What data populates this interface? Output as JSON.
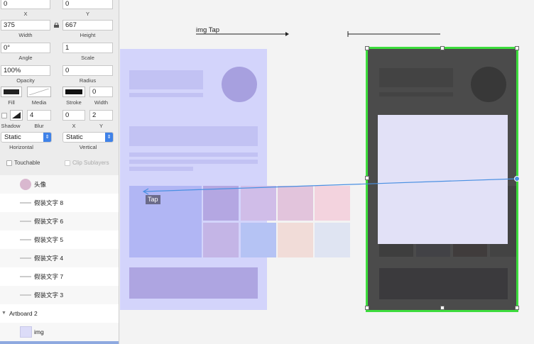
{
  "inspector": {
    "x": {
      "value": "0",
      "label": "X"
    },
    "y": {
      "value": "0",
      "label": "Y"
    },
    "width": {
      "value": "375",
      "label": "Width"
    },
    "height": {
      "value": "667",
      "label": "Height"
    },
    "angle": {
      "value": "0°",
      "label": "Angle"
    },
    "scale": {
      "value": "1",
      "label": "Scale"
    },
    "opacity": {
      "value": "100%",
      "label": "Opacity"
    },
    "radius": {
      "value": "0",
      "label": "Radius"
    },
    "fill_label": "Fill",
    "media_label": "Media",
    "stroke_label": "Stroke",
    "stroke_width": {
      "value": "0",
      "label": "Width"
    },
    "shadow_label": "Shadow",
    "blur": {
      "value": "4",
      "label": "Blur"
    },
    "shadow_x": {
      "value": "0",
      "label": "X"
    },
    "shadow_y": {
      "value": "2",
      "label": "Y"
    },
    "horizontal": {
      "value": "Static",
      "label": "Horizontal"
    },
    "vertical": {
      "value": "Static",
      "label": "Vertical"
    },
    "touchable_label": "Touchable",
    "clip_sublayers_label": "Clip Sublayers",
    "colors": {
      "fill": "#222222",
      "stroke": "#111111",
      "shadow": "#222222"
    }
  },
  "layers": [
    {
      "label": "头像",
      "icon": "avatar-circle-icon"
    },
    {
      "label": "假装文字 8"
    },
    {
      "label": "假装文字 6"
    },
    {
      "label": "假装文字 5"
    },
    {
      "label": "假装文字 4"
    },
    {
      "label": "假装文字 7"
    },
    {
      "label": "假装文字 3"
    },
    {
      "label": "Artboard 2",
      "icon": "disclosure-triangle-icon"
    },
    {
      "label": "img",
      "icon": "image-thumbnail-icon"
    }
  ],
  "canvas": {
    "transition_label": "img Tap",
    "tap_label": "Tap",
    "colors": {
      "artboard_left": "#d3d4fb",
      "artboard_right": "#4b4b4b",
      "selection": "#3ddc3d",
      "link_line": "#4a90e2",
      "img_card": "#e2e1f7"
    }
  }
}
